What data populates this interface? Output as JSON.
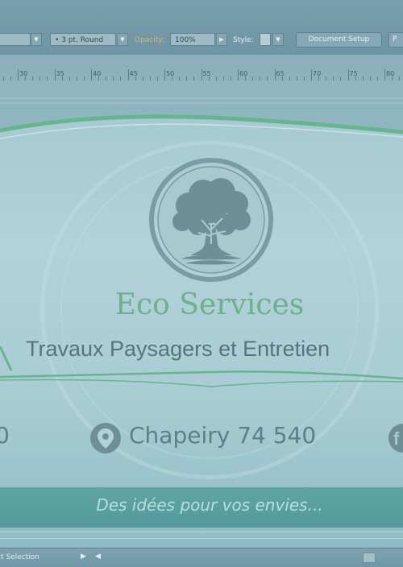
{
  "control_bar": {
    "stroke_profile": "3 pt. Round",
    "opacity_label": "Opacity:",
    "opacity_value": "100%",
    "style_label": "Style:",
    "document_setup_label": "Document Setup",
    "next_button_label": "P"
  },
  "ruler": {
    "ticks": [
      "30",
      "35",
      "40",
      "45",
      "50",
      "55",
      "60",
      "65",
      "70",
      "75",
      "80"
    ]
  },
  "artboard": {
    "brand_name": "Eco Services",
    "tagline": "Travaux Paysagers et Entretien",
    "phone_fragment": "0",
    "address": "Chapeiry 74 540",
    "facebook_glyph": "f",
    "slogan": "Des idées pour vos envies...",
    "colors": {
      "brand_green": "#6db08a",
      "band_teal": "#5fa6a3",
      "logo_grey": "#6f8f98"
    }
  },
  "status_bar": {
    "tool_label": "ct Selection"
  },
  "icons": {
    "logo": "tree-in-circle-logo",
    "location": "map-pin-icon",
    "social": "facebook-icon"
  }
}
